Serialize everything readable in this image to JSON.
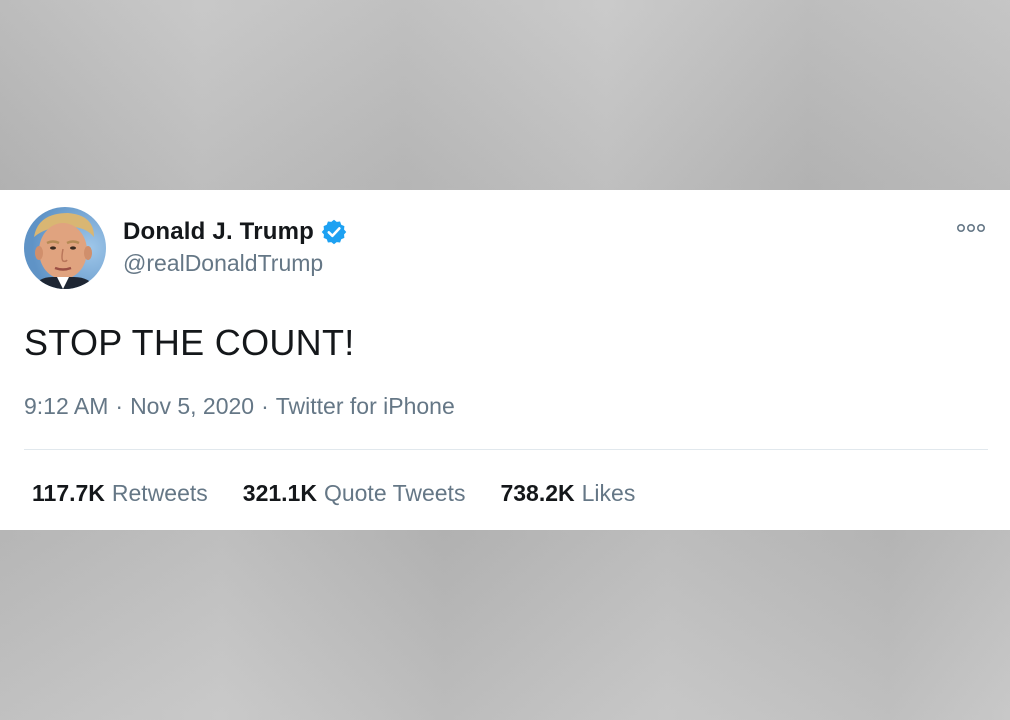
{
  "tweet": {
    "author": {
      "display_name": "Donald J. Trump",
      "handle": "@realDonaldTrump",
      "verified": true
    },
    "text": "STOP THE COUNT!",
    "meta": {
      "time": "9:12 AM",
      "date": "Nov 5, 2020",
      "source": "Twitter for iPhone",
      "separator": "·"
    },
    "stats": [
      {
        "value": "117.7K",
        "label": "Retweets"
      },
      {
        "value": "321.1K",
        "label": "Quote Tweets"
      },
      {
        "value": "738.2K",
        "label": "Likes"
      }
    ]
  },
  "icons": {
    "verified": "verified-badge-icon",
    "more": "more-options-icon"
  },
  "colors": {
    "verified_blue": "#1da1f2",
    "text_primary": "#14171a",
    "text_secondary": "#657786",
    "divider": "#e1e8ed",
    "card_background": "#ffffff"
  }
}
